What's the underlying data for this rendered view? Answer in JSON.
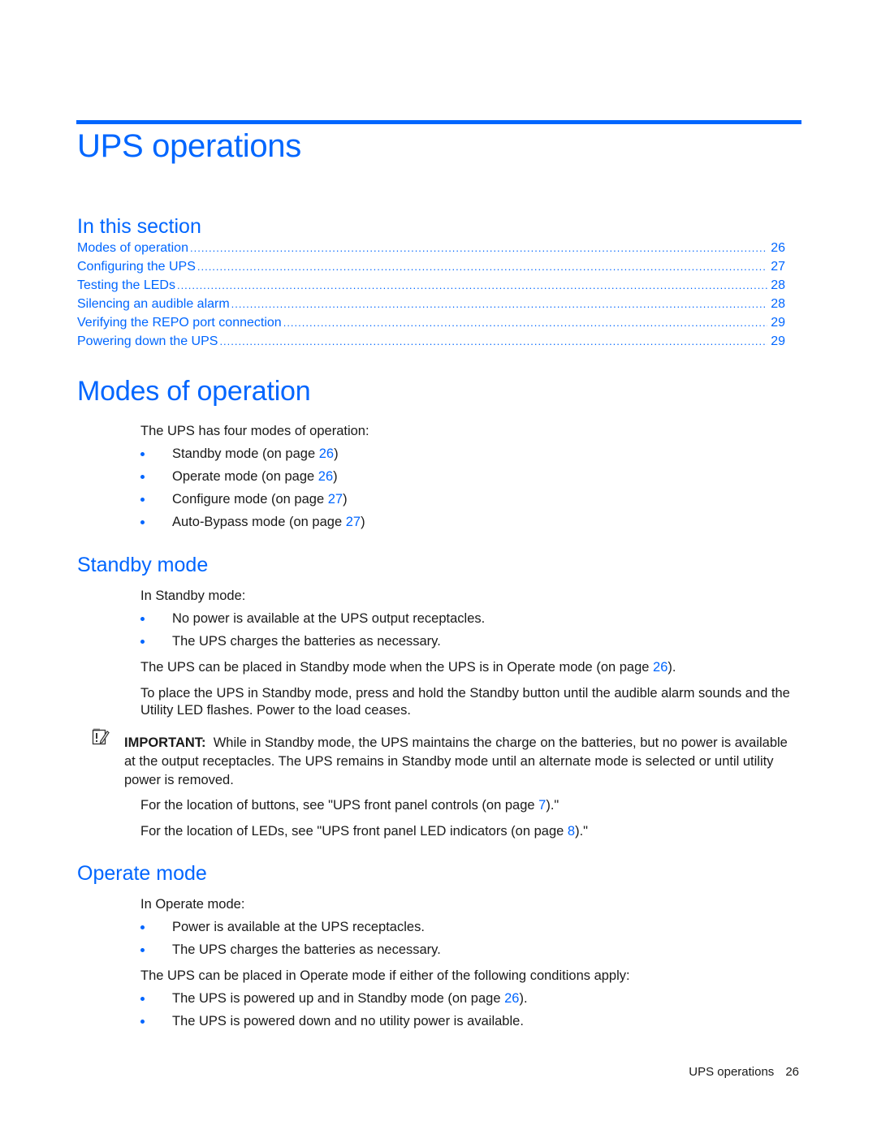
{
  "chapter": {
    "title": "UPS operations"
  },
  "toc": {
    "heading": "In this section",
    "entries": [
      {
        "title": "Modes of operation",
        "page": "26"
      },
      {
        "title": "Configuring the UPS",
        "page": "27"
      },
      {
        "title": "Testing the LEDs",
        "page": "28"
      },
      {
        "title": "Silencing an audible alarm",
        "page": "28"
      },
      {
        "title": "Verifying the REPO port connection",
        "page": "29"
      },
      {
        "title": "Powering down the UPS",
        "page": "29"
      }
    ]
  },
  "modes": {
    "title": "Modes of operation",
    "intro": "The UPS has four modes of operation:",
    "items": [
      {
        "text": "Standby mode (on page ",
        "page": "26",
        "suffix": ")"
      },
      {
        "text": "Operate mode (on page ",
        "page": "26",
        "suffix": ")"
      },
      {
        "text": "Configure mode (on page ",
        "page": "27",
        "suffix": ")"
      },
      {
        "text": "Auto-Bypass mode (on page ",
        "page": "27",
        "suffix": ")"
      }
    ]
  },
  "standby": {
    "title": "Standby mode",
    "intro": "In Standby mode:",
    "bullets": [
      "No power is available at the UPS output receptacles.",
      "The UPS charges the batteries as necessary."
    ],
    "placed": {
      "text": "The UPS can be placed in Standby mode when the UPS is in Operate mode (on page ",
      "page": "26",
      "suffix": ")."
    },
    "instruction": "To place the UPS in Standby mode, press and hold the Standby button until the audible alarm sounds and the Utility LED flashes. Power to the load ceases.",
    "important": {
      "label": "IMPORTANT:",
      "text": "While in Standby mode, the UPS maintains the charge on the batteries, but no power is available at the output receptacles. The UPS remains in Standby mode until an alternate mode is selected or until utility power is removed."
    },
    "buttons_ref": {
      "text": "For the location of buttons, see \"UPS front panel controls (on page ",
      "page": "7",
      "suffix": ").\""
    },
    "leds_ref": {
      "text": "For the location of LEDs, see \"UPS front panel LED indicators (on page ",
      "page": "8",
      "suffix": ").\""
    }
  },
  "operate": {
    "title": "Operate mode",
    "intro": "In Operate mode:",
    "bullets": [
      "Power is available at the UPS receptacles.",
      "The UPS charges the batteries as necessary."
    ],
    "conditions_intro": "The UPS can be placed in Operate mode if either of the following conditions apply:",
    "conditions": [
      {
        "text": "The UPS is powered up and in Standby mode (on page ",
        "page": "26",
        "suffix": ")."
      },
      {
        "text": "The UPS is powered down and no utility power is available.",
        "page": null,
        "suffix": ""
      }
    ]
  },
  "footer": {
    "section": "UPS operations",
    "page": "26"
  },
  "colors": {
    "accent": "#0066ff",
    "text": "#1a1a1a"
  }
}
